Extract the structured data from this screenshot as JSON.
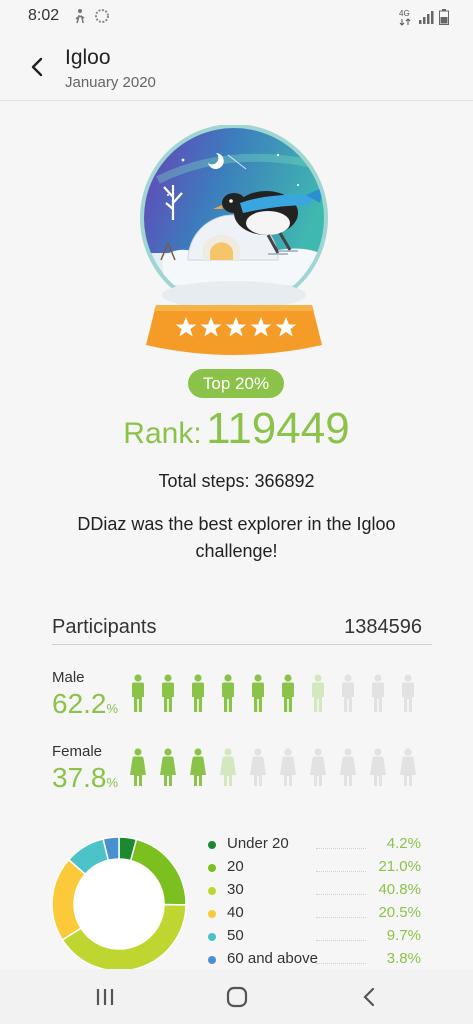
{
  "status_bar": {
    "time": "8:02",
    "network": "4G"
  },
  "header": {
    "title": "Igloo",
    "subtitle": "January 2020"
  },
  "badge": {
    "label": "Top 20%"
  },
  "rank": {
    "label": "Rank:",
    "value": "119449"
  },
  "total_steps": "Total steps: 366892",
  "message": "DDiaz was the best explorer in the Igloo challenge!",
  "participants": {
    "label": "Participants",
    "value": "1384596"
  },
  "male": {
    "label": "Male",
    "value": "62.2",
    "unit": "%",
    "filled": 6,
    "partial": 1,
    "total": 10
  },
  "female": {
    "label": "Female",
    "value": "37.8",
    "unit": "%",
    "filled": 3,
    "partial": 1,
    "total": 10
  },
  "colors": {
    "accent": "#8bc34a",
    "person_filled": "#8bc34a",
    "person_partial": "#d3e8bf",
    "person_empty": "#e2e2e2"
  },
  "chart_data": {
    "type": "pie",
    "categories": [
      "Under 20",
      "20",
      "30",
      "40",
      "50",
      "60 and above"
    ],
    "values": [
      4.2,
      21.0,
      40.8,
      20.5,
      9.7,
      3.8
    ],
    "value_labels": [
      "4.2%",
      "21.0%",
      "40.8%",
      "20.5%",
      "9.7%",
      "3.8%"
    ],
    "colors": [
      "#1b8a2e",
      "#7cc020",
      "#c0d630",
      "#fbc93a",
      "#4cc3c8",
      "#4a8fd0"
    ]
  },
  "nav": {
    "recents_icon": "recents-icon",
    "home_icon": "home-icon",
    "back_icon": "back-icon"
  }
}
